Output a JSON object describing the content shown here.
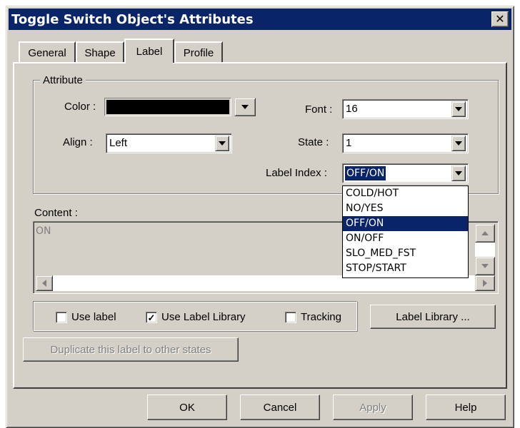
{
  "window": {
    "title": "Toggle Switch Object's Attributes",
    "close_glyph": "✕"
  },
  "tabs": [
    {
      "label": "General"
    },
    {
      "label": "Shape"
    },
    {
      "label": "Label"
    },
    {
      "label": "Profile"
    }
  ],
  "active_tab": "Label",
  "attribute_group": {
    "title": "Attribute",
    "color_label": "Color :",
    "color_value": "#000000",
    "font_label": "Font :",
    "font_value": "16",
    "align_label": "Align :",
    "align_value": "Left",
    "state_label": "State :",
    "state_value": "1",
    "label_index_label": "Label Index :",
    "label_index_value": "OFF/ON"
  },
  "label_index_options": [
    "COLD/HOT",
    "NO/YES",
    "OFF/ON",
    "ON/OFF",
    "SLO_MED_FST",
    "STOP/START"
  ],
  "content": {
    "label": "Content :",
    "text": "ON"
  },
  "checkboxes": {
    "use_label": {
      "label": "Use label",
      "checked": false
    },
    "use_label_library": {
      "label": "Use Label Library",
      "checked": true,
      "mark": "✓"
    },
    "tracking": {
      "label": "Tracking",
      "checked": false
    }
  },
  "buttons": {
    "label_library": "Label Library ...",
    "duplicate": "Duplicate this label to other states",
    "ok": "OK",
    "cancel": "Cancel",
    "apply": "Apply",
    "help": "Help"
  },
  "colors": {
    "titlebar": "#0a246a",
    "face": "#d4d0c8",
    "selection": "#0a246a"
  }
}
